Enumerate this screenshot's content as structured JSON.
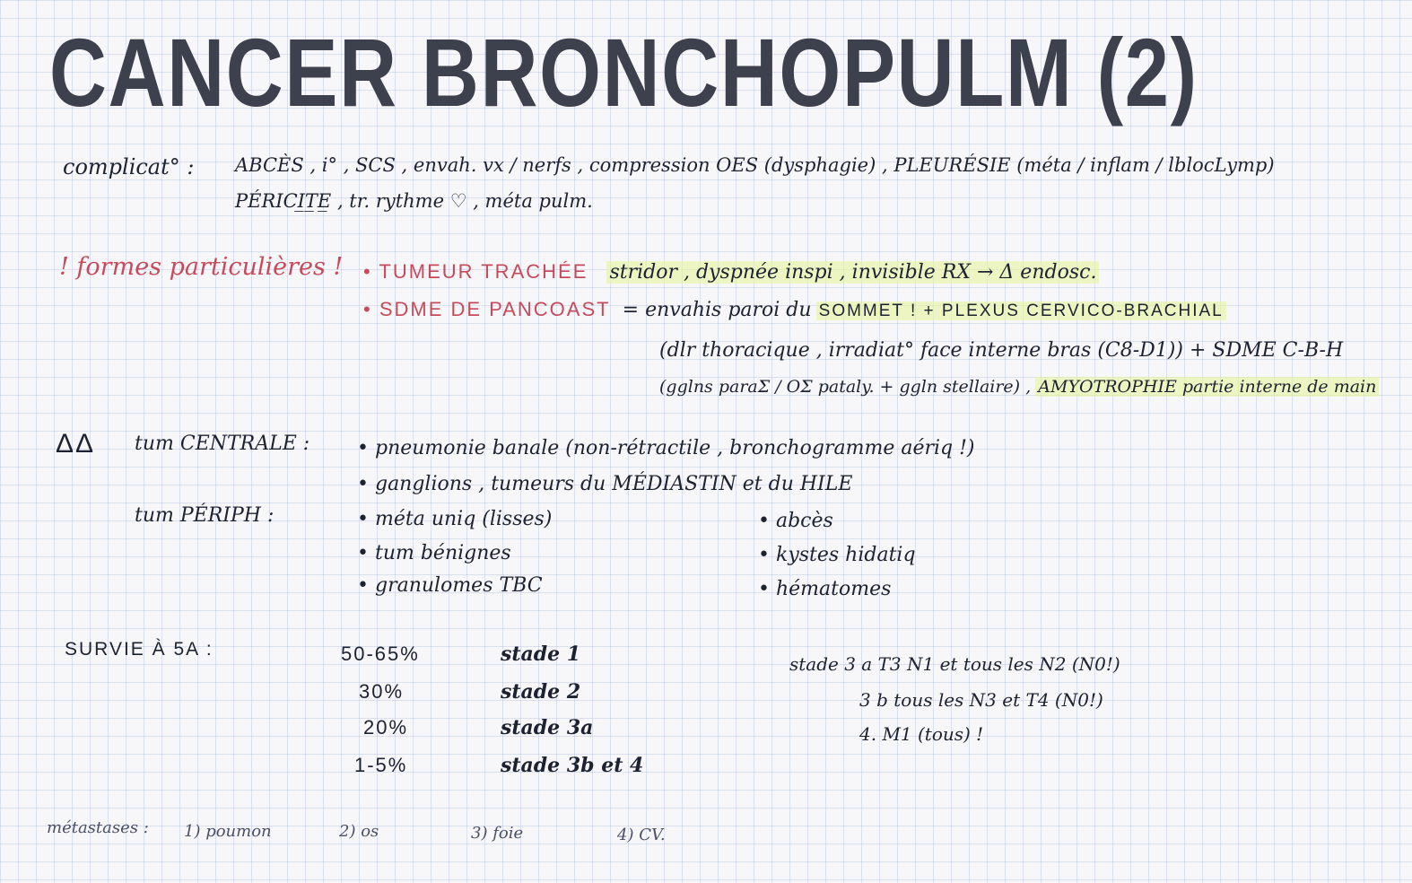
{
  "title": "CANCER BRONCHOPULM (2)",
  "complications": {
    "label": "complicat° :",
    "line1": "ABCÈS , i° , SCS , envah. vx / nerfs , compression OES (dysphagie) , PLEURÉSIE (méta / inflam / lblocLymp)",
    "line2": "PÉRICI̲T̲E̲ , tr. rythme ♡ , méta pulm."
  },
  "formes": {
    "label": "! formes particulières !",
    "items": [
      {
        "name": "TUMEUR TRACHÉE",
        "desc": "stridor , dyspnée inspi , invisible RX → Δ endosc."
      },
      {
        "name": "SDME DE PANCOAST",
        "desc_prefix": "= envahis paroi du",
        "desc_hl1": "SOMMET ! + PLEXUS CERVICO-BRACHIAL",
        "line2": "(dlr thoracique , irradiat° face interne bras (C8-D1)) + SDME C-B-H",
        "line3_prefix": "(gglns paraΣ / OΣ pataly. + ggln stellaire) ,",
        "line3_hl": "AMYOTROPHIE partie interne de main"
      }
    ]
  },
  "dd": {
    "label": "ΔΔ",
    "centrale_label": "tum CENTRALE :",
    "centrale": [
      "pneumonie banale (non-rétractile , bronchogramme aériq !)",
      "ganglions , tumeurs du MÉDIASTIN et du HILE"
    ],
    "periph_label": "tum PÉRIPH :",
    "periph_left": [
      "méta uniq (lisses)",
      "tum bénignes",
      "granulomes TBC"
    ],
    "periph_right": [
      "abcès",
      "kystes hidatiq",
      "hématomes"
    ]
  },
  "survie": {
    "label": "SURVIE À 5A :",
    "rows": [
      {
        "pct": "50-65%",
        "stade": "stade 1"
      },
      {
        "pct": "30%",
        "stade": "stade 2"
      },
      {
        "pct": "20%",
        "stade": "stade 3a"
      },
      {
        "pct": "1-5%",
        "stade": "stade 3b et 4"
      }
    ],
    "notes": [
      "stade 3 a  T3 N1  et tous les N2 (N0!)",
      "3 b  tous les N3  et T4  (N0!)",
      "4.  M1 (tous) !"
    ]
  },
  "metastases": {
    "label": "métastases :",
    "items": [
      "1) poumon",
      "2) os",
      "3) foie",
      "4) CV."
    ]
  }
}
